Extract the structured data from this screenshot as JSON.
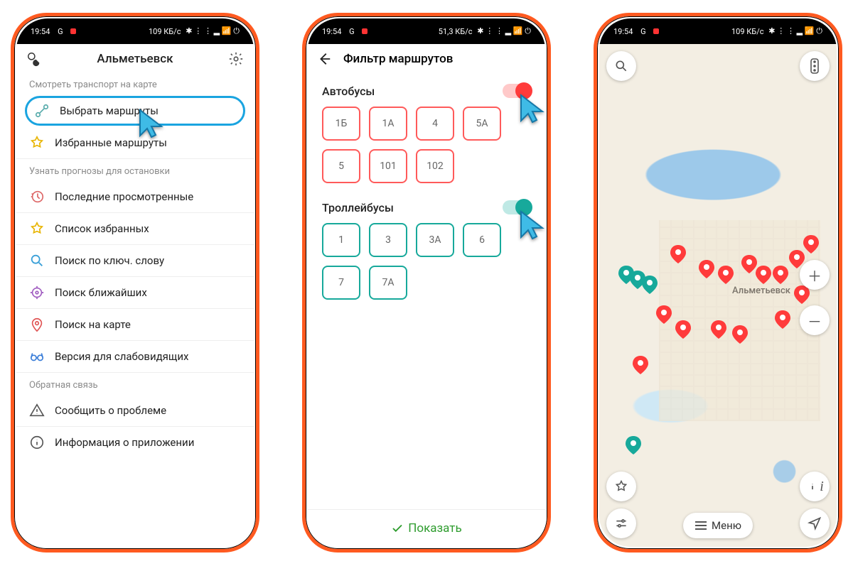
{
  "status": {
    "time": "19:54",
    "net_left": "G",
    "speed1": "109 КБ/с",
    "speed2": "51,3 КБ/с"
  },
  "phone1": {
    "title": "Альметьевск",
    "sec1_head": "Смотреть транспорт на карте",
    "select_routes": "Выбрать маршруты",
    "fav_routes": "Избранные маршруты",
    "sec2_head": "Узнать прогнозы для остановки",
    "recent": "Последние просмотренные",
    "fav_list": "Список избранных",
    "search_keyword": "Поиск по ключ. слову",
    "search_nearby": "Поиск ближайших",
    "search_map": "Поиск на карте",
    "accessibility": "Версия для слабовидящих",
    "sec3_head": "Обратная связь",
    "report": "Сообщить о проблеме",
    "about": "Информация о приложении"
  },
  "phone2": {
    "title": "Фильтр маршрутов",
    "buses": "Автобусы",
    "bus_routes": [
      "1Б",
      "1А",
      "4",
      "5А",
      "5",
      "101",
      "102"
    ],
    "trolleys": "Троллейбусы",
    "trolley_routes": [
      "1",
      "3",
      "3А",
      "6",
      "7",
      "7А"
    ],
    "show": "Показать"
  },
  "phone3": {
    "city": "Альметьевск",
    "menu": "Меню"
  }
}
